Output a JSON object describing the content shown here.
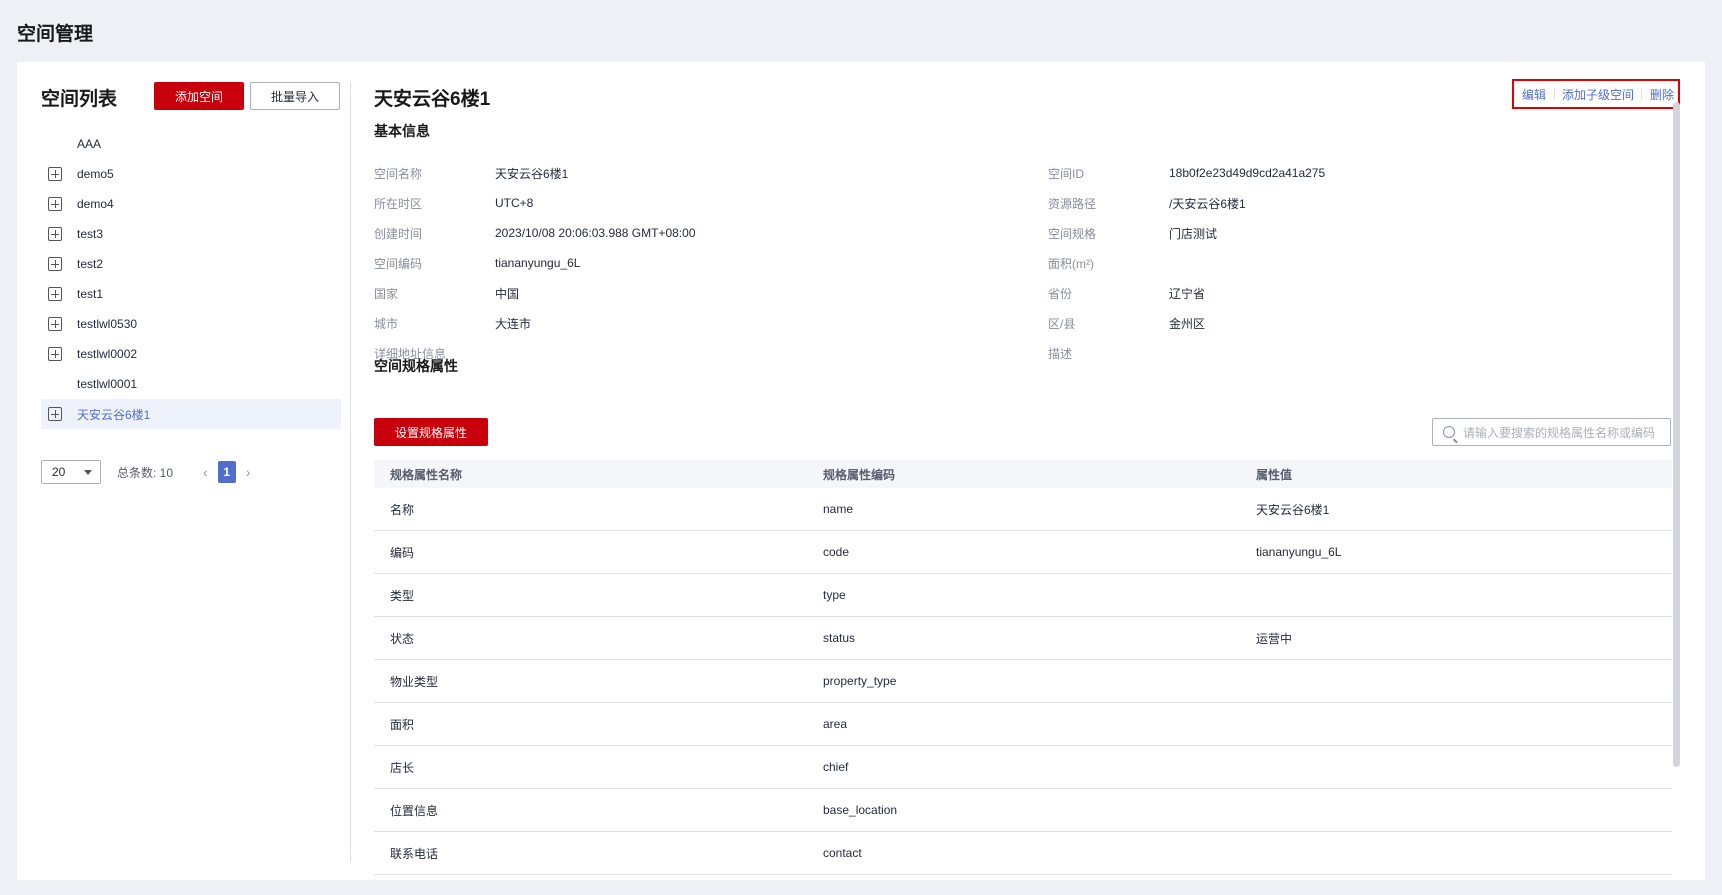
{
  "page": {
    "title": "空间管理"
  },
  "left": {
    "title": "空间列表",
    "add_label": "添加空间",
    "import_label": "批量导入",
    "tree": [
      {
        "label": "AAA",
        "expandable": false,
        "active": false
      },
      {
        "label": "demo5",
        "expandable": true,
        "active": false
      },
      {
        "label": "demo4",
        "expandable": true,
        "active": false
      },
      {
        "label": "test3",
        "expandable": true,
        "active": false
      },
      {
        "label": "test2",
        "expandable": true,
        "active": false
      },
      {
        "label": "test1",
        "expandable": true,
        "active": false
      },
      {
        "label": "testlwl0530",
        "expandable": true,
        "active": false
      },
      {
        "label": "testlwl0002",
        "expandable": true,
        "active": false
      },
      {
        "label": "testlwl0001",
        "expandable": false,
        "active": false
      },
      {
        "label": "天安云谷6楼1",
        "expandable": true,
        "active": true
      }
    ],
    "pager": {
      "page_size": "20",
      "total": "总条数: 10",
      "current": "1",
      "prev": "‹",
      "next": "›"
    }
  },
  "detail": {
    "title": "天安云谷6楼1",
    "actions": {
      "edit": "编辑",
      "add_child": "添加子级空间",
      "delete": "删除"
    },
    "basic_title": "基本信息",
    "basic": [
      {
        "l1": "空间名称",
        "v1": "天安云谷6楼1",
        "l2": "空间ID",
        "v2": "18b0f2e23d49d9cd2a41a275"
      },
      {
        "l1": "所在时区",
        "v1": "UTC+8",
        "l2": "资源路径",
        "v2": "/天安云谷6楼1"
      },
      {
        "l1": "创建时间",
        "v1": "2023/10/08 20:06:03.988 GMT+08:00",
        "l2": "空间规格",
        "v2": "门店测试"
      },
      {
        "l1": "空间编码",
        "v1": "tiananyungu_6L",
        "l2": "面积(m²)",
        "v2": ""
      },
      {
        "l1": "国家",
        "v1": "中国",
        "l2": "省份",
        "v2": "辽宁省"
      },
      {
        "l1": "城市",
        "v1": "大连市",
        "l2": "区/县",
        "v2": "金州区"
      },
      {
        "l1": "详细地址信息",
        "v1": "",
        "l2": "描述",
        "v2": ""
      }
    ],
    "spec_title": "空间规格属性",
    "set_attr_label": "设置规格属性",
    "search_placeholder": "请输入要搜索的规格属性名称或编码",
    "table": {
      "headers": [
        "规格属性名称",
        "规格属性编码",
        "属性值"
      ],
      "rows": [
        [
          "名称",
          "name",
          "天安云谷6楼1"
        ],
        [
          "编码",
          "code",
          "tiananyungu_6L"
        ],
        [
          "类型",
          "type",
          ""
        ],
        [
          "状态",
          "status",
          "运营中"
        ],
        [
          "物业类型",
          "property_type",
          ""
        ],
        [
          "面积",
          "area",
          ""
        ],
        [
          "店长",
          "chief",
          ""
        ],
        [
          "位置信息",
          "base_location",
          ""
        ],
        [
          "联系电话",
          "contact",
          ""
        ]
      ]
    }
  }
}
